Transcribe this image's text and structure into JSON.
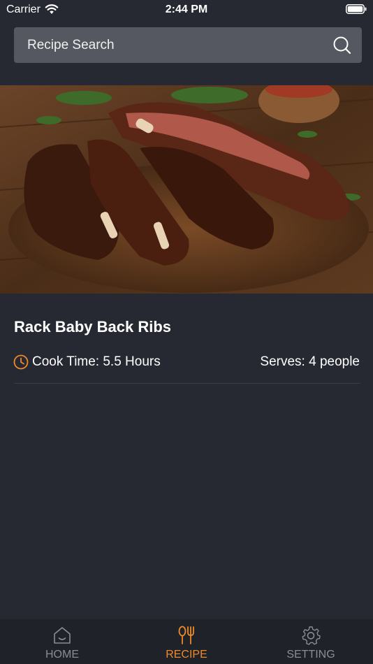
{
  "status_bar": {
    "carrier": "Carrier",
    "time": "2:44 PM",
    "icons": [
      "wifi-icon",
      "battery-icon"
    ]
  },
  "search": {
    "placeholder": "Recipe Search",
    "icon": "search-icon"
  },
  "recipe": {
    "image": "barbecue ribs on wooden board",
    "title": "Rack Baby Back Ribs",
    "cook_time": "Cook Time: 5.5 Hours",
    "serves": "Serves: 4 people"
  },
  "tabs": [
    {
      "label": "HOME",
      "icon": "home-icon",
      "active": false
    },
    {
      "label": "RECIPE",
      "icon": "fork-spoon-icon",
      "active": true
    },
    {
      "label": "SETTING",
      "icon": "gear-icon",
      "active": false
    }
  ],
  "colors": {
    "background": "#262931",
    "search_background": "#555860",
    "tab_bar": "#1f2228",
    "accent": "#f0892a",
    "inactive": "#8a8d93"
  }
}
